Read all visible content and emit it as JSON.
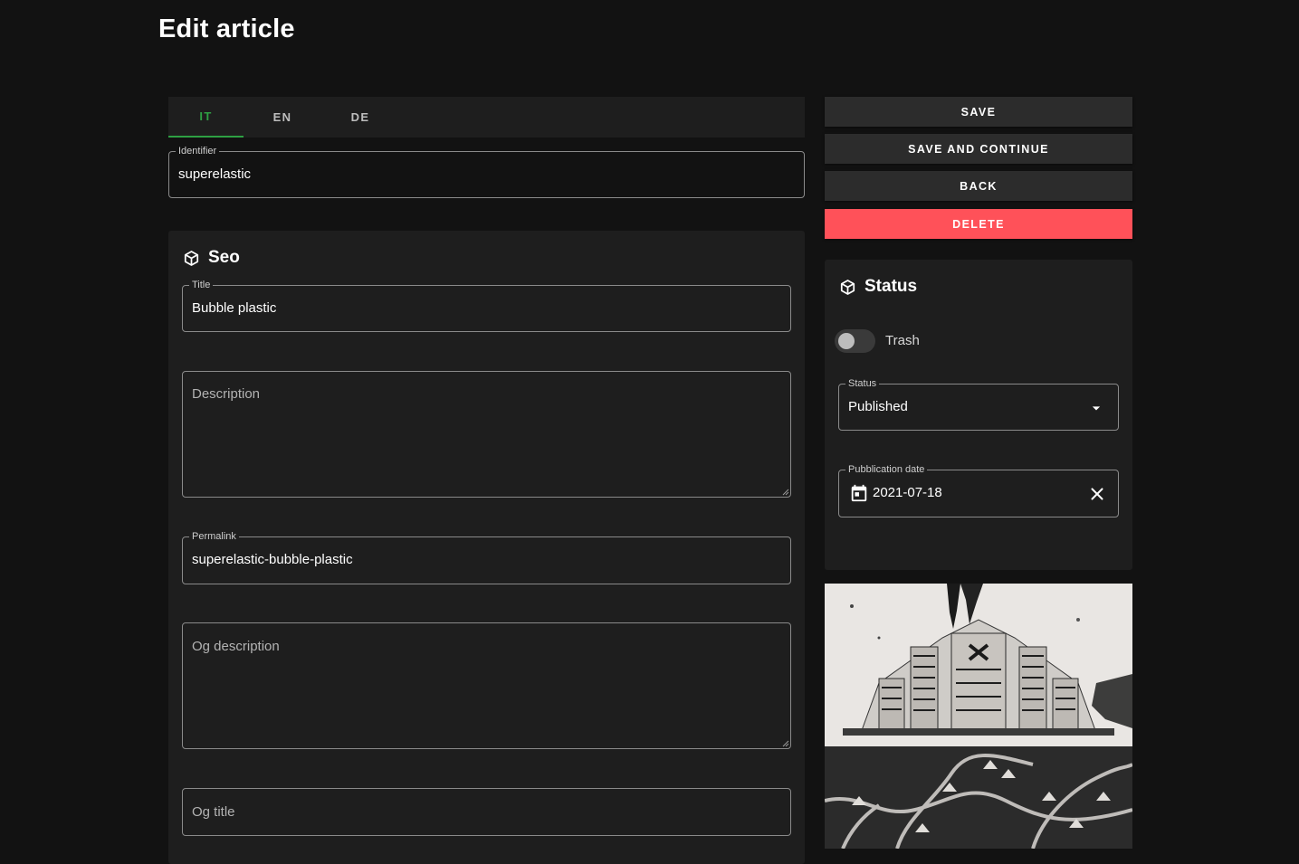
{
  "page": {
    "title": "Edit article"
  },
  "tabs": [
    {
      "label": "IT",
      "active": true
    },
    {
      "label": "EN",
      "active": false
    },
    {
      "label": "DE",
      "active": false
    }
  ],
  "identifier": {
    "label": "Identifier",
    "value": "superelastic"
  },
  "seo": {
    "header": "Seo",
    "icon": "cube-icon",
    "title_field": {
      "label": "Title",
      "value": "Bubble plastic"
    },
    "description_field": {
      "placeholder": "Description",
      "value": ""
    },
    "permalink_field": {
      "label": "Permalink",
      "value": "superelastic-bubble-plastic"
    },
    "og_description_field": {
      "placeholder": "Og description",
      "value": ""
    },
    "og_title_field": {
      "placeholder": "Og title",
      "value": ""
    }
  },
  "actions": {
    "save": "SAVE",
    "save_and_continue": "SAVE AND CONTINUE",
    "back": "BACK",
    "delete": "DELETE"
  },
  "status_card": {
    "header": "Status",
    "icon": "cube-icon",
    "trash_label": "Trash",
    "trash_on": false,
    "status_field": {
      "label": "Status",
      "value": "Published"
    },
    "publication_date": {
      "label": "Pubblication date",
      "value": "2021-07-18"
    }
  },
  "colors": {
    "background": "#121212",
    "card": "#1e1e1e",
    "accent_tab": "#2ea043",
    "danger": "#ff5159",
    "button": "#2c2c2c"
  }
}
